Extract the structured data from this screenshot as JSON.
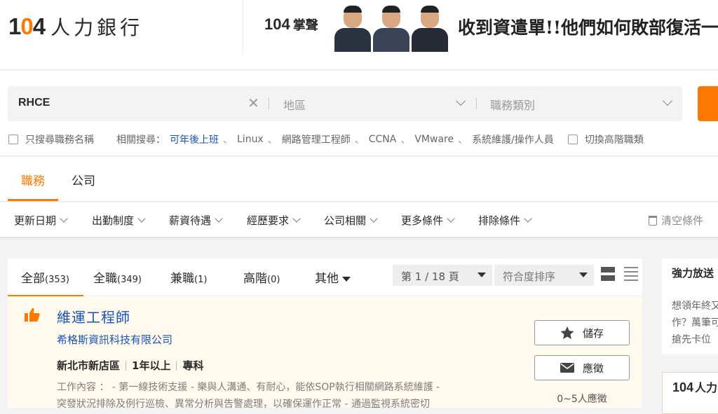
{
  "header": {
    "logo_num_1": "1",
    "logo_num_o": "0",
    "logo_num_4": "4",
    "logo_text": "人力銀行"
  },
  "banner": {
    "logo_num": "104",
    "logo_tail": "掌聲",
    "headline": "收到資遣單!!他們如何敗部復活一"
  },
  "search": {
    "keyword": "RHCE",
    "area_placeholder": "地區",
    "category_placeholder": "職務類別",
    "only_title_label": "只搜尋職務名稱",
    "related_label": "相關搜尋：",
    "related": [
      "可年後上班",
      "Linux",
      "網路管理工程師",
      "CCNA",
      "VMware",
      "系統維護/操作人員"
    ],
    "senior_toggle_label": "切換高階職類"
  },
  "main_tabs": [
    {
      "label": "職務",
      "active": true
    },
    {
      "label": "公司",
      "active": false
    }
  ],
  "filters": [
    "更新日期",
    "出勤制度",
    "薪資待遇",
    "經歷要求",
    "公司相關",
    "更多條件",
    "排除條件"
  ],
  "clear_all_label": "清空條件",
  "list_tabs": [
    {
      "label": "全部",
      "count": "(353)",
      "active": true
    },
    {
      "label": "全職",
      "count": "(349)",
      "active": false
    },
    {
      "label": "兼職",
      "count": "(1)",
      "active": false
    },
    {
      "label": "高階",
      "count": "(0)",
      "active": false
    },
    {
      "label": "其他",
      "count": "",
      "active": false
    }
  ],
  "pagination": {
    "page_label": "第 1 / 18 頁"
  },
  "sort": {
    "label": "符合度排序"
  },
  "job": {
    "title": "維運工程師",
    "company": "希格斯資訊科技有限公司",
    "location": "新北市新店區",
    "experience": "1年以上",
    "education": "專科",
    "desc_line1": "工作內容 ： - 第一線技術支援 - 樂與人溝通、有耐心，能依SOP執行相關網路系統維護 -",
    "desc_line2": "突發狀況排除及例行巡檢、異常分析與告警處理，以確保運作正常 - 通過監視系統密切",
    "save_label": "儲存",
    "apply_label": "應徵",
    "applicants": "0~5人應徵"
  },
  "right_panel": {
    "title": "強力放送",
    "line1": "想領年終又",
    "line2": "作？萬筆可",
    "line3": "搶先卡位"
  },
  "right_ad": {
    "logo_num": "104",
    "text": "人力"
  },
  "colors": {
    "accent": "#ff7800",
    "link": "#1654b9"
  }
}
